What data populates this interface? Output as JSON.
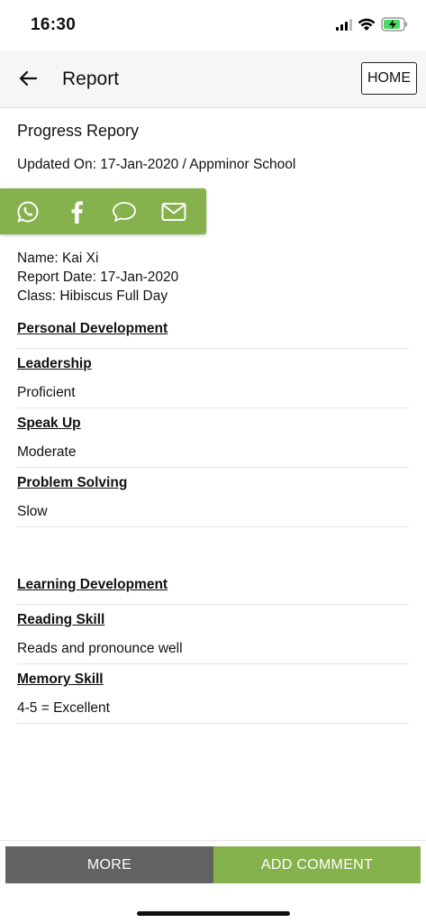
{
  "status_bar": {
    "time": "16:30"
  },
  "app_bar": {
    "title": "Report",
    "home_label": "HOME"
  },
  "report": {
    "title": "Progress Repory",
    "updated": "Updated On: 17-Jan-2020 / Appminor School",
    "name": "Name: Kai Xi",
    "report_date": "Report Date: 17-Jan-2020",
    "class": "Class: Hibiscus Full Day"
  },
  "share": {
    "icons": [
      "whatsapp-icon",
      "facebook-icon",
      "chat-bubble-icon",
      "email-icon"
    ],
    "color": "#86b24e"
  },
  "sections": [
    {
      "title": "Personal Development",
      "items": [
        {
          "label": "Leadership",
          "value": "Proficient"
        },
        {
          "label": "Speak Up",
          "value": "Moderate"
        },
        {
          "label": "Problem Solving",
          "value": "Slow"
        }
      ]
    },
    {
      "title": "Learning Development",
      "items": [
        {
          "label": "Reading Skill",
          "value": "Reads and pronounce well"
        },
        {
          "label": "Memory Skill",
          "value": "4-5 = Excellent"
        }
      ]
    }
  ],
  "bottom": {
    "more_label": "MORE",
    "add_comment_label": "ADD COMMENT",
    "more_color": "#626262",
    "add_color": "#86b24e"
  }
}
